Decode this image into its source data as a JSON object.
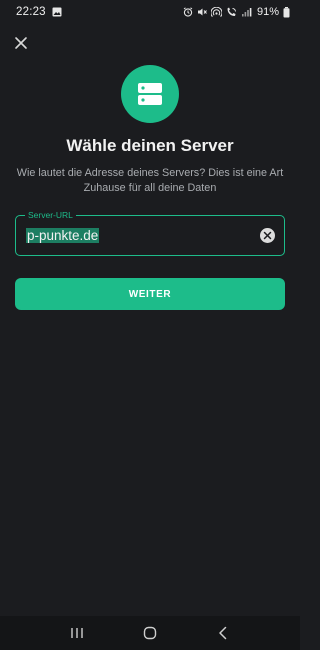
{
  "status_bar": {
    "time": "22:23",
    "battery_percent": "91%",
    "icons": [
      "gallery-icon",
      "alarm-icon",
      "mute-icon",
      "hotspot-icon",
      "wifi-call-icon",
      "signal-icon",
      "battery-icon"
    ]
  },
  "header": {
    "close_icon": "close-icon"
  },
  "hero": {
    "icon": "server-icon",
    "color": "#1dbc8a"
  },
  "content": {
    "title": "Wähle deinen Server",
    "subtitle": "Wie lautet die Adresse deines Servers? Dies ist eine Art Zuhause für all deine Daten"
  },
  "server_field": {
    "label": "Server-URL",
    "value": "p-punkte.de"
  },
  "actions": {
    "continue_label": "WEITER"
  },
  "colors": {
    "accent": "#1dbc8a",
    "background": "#1b1c1f"
  },
  "navbar": {
    "icons": [
      "recent-apps-icon",
      "home-icon",
      "back-icon"
    ]
  }
}
